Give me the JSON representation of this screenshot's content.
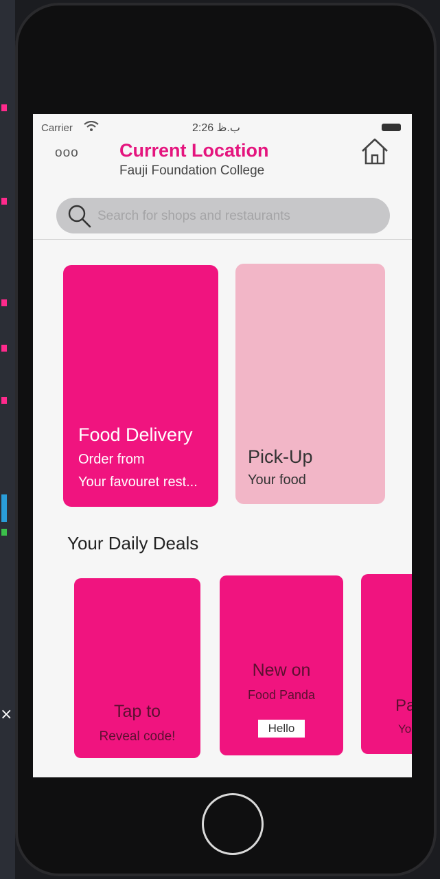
{
  "status": {
    "carrier": "Carrier",
    "time": "2:26 ب.ظ"
  },
  "header": {
    "menu": "ooo",
    "title": "Current Location",
    "subtitle": "Fauji Foundation College"
  },
  "search": {
    "placeholder": "Search for shops and restaurants",
    "value": ""
  },
  "cards": {
    "food": {
      "title": "Food Delivery",
      "line1": "Order from",
      "line2": "Your favouret rest..."
    },
    "pickup": {
      "title": "Pick-Up",
      "line1": "Your food"
    }
  },
  "section": {
    "title": "Your Daily Deals"
  },
  "deals": [
    {
      "title": "Tap to",
      "subtitle": "Reveal code!"
    },
    {
      "title": "New on",
      "subtitle": "Food Panda",
      "tag": "Hello"
    },
    {
      "title": "Pa",
      "subtitle": "Yo"
    }
  ],
  "background": {
    "close": "×"
  },
  "colors": {
    "brand": "#e4157e",
    "card": "#f0147f",
    "pickup": "#f2b6c7"
  }
}
